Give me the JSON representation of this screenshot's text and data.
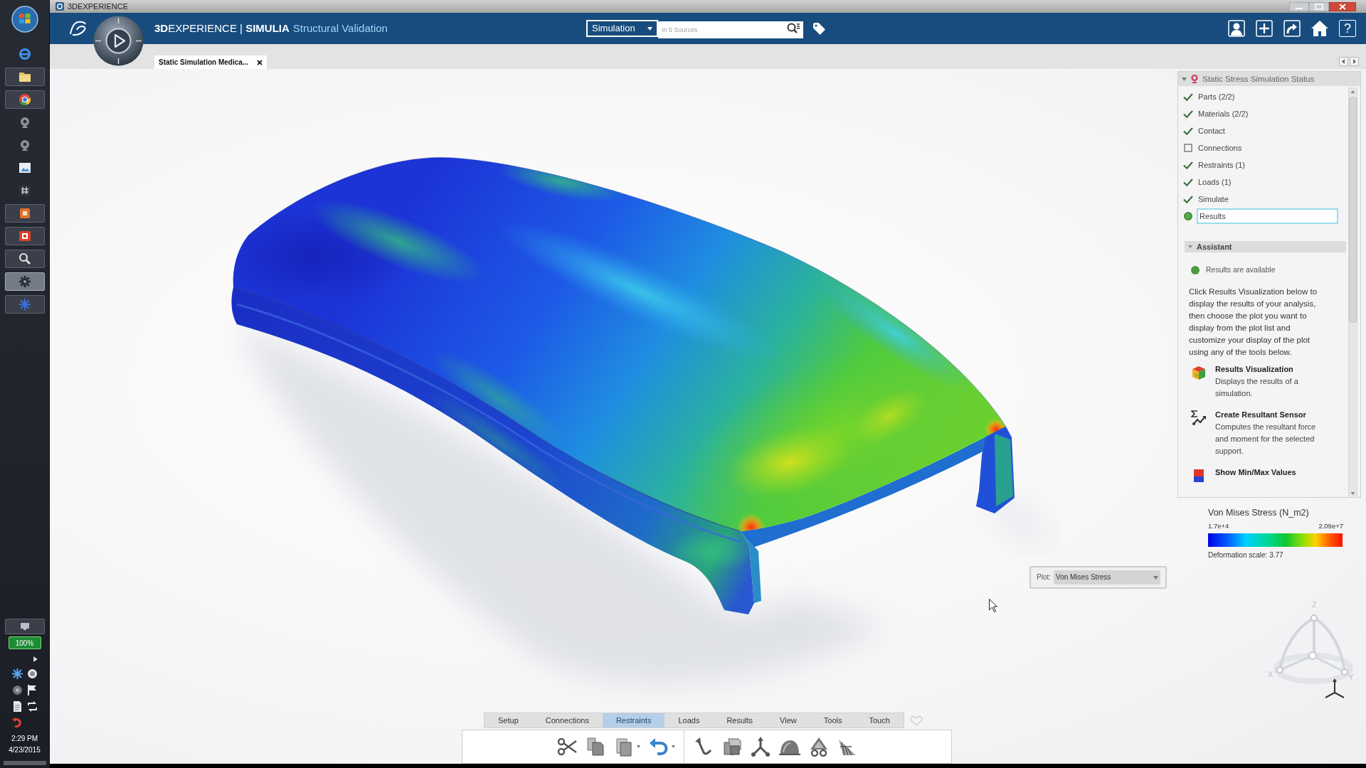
{
  "window": {
    "title": "3DEXPERIENCE"
  },
  "taskbar": {
    "apps": [
      {
        "running": false,
        "selected": false
      },
      {
        "running": true,
        "selected": false
      },
      {
        "running": true,
        "selected": false
      },
      {
        "running": false,
        "selected": false
      },
      {
        "running": false,
        "selected": false
      },
      {
        "running": false,
        "selected": false
      },
      {
        "running": false,
        "selected": false
      },
      {
        "running": true,
        "selected": false
      },
      {
        "running": true,
        "selected": false
      },
      {
        "running": true,
        "selected": false
      },
      {
        "running": true,
        "selected": true
      },
      {
        "running": true,
        "selected": false
      }
    ],
    "battery": "100%",
    "time": "2:29 PM",
    "date": "4/23/2015"
  },
  "top_bar": {
    "brand": "**3D**EXPERIENCE | **SIMULIA**",
    "app": "Structural Validation",
    "search": {
      "scope": "Simulation",
      "placeholder": "In 5 Sources"
    },
    "help": "?"
  },
  "tabs": [
    {
      "label": "Static Simulation Medica...",
      "selected": true
    }
  ],
  "status_panel": {
    "title": "Static Stress Simulation Status",
    "expanded": true,
    "steps": [
      {
        "label": "Parts (2/2)",
        "checked": true,
        "current": false,
        "selected": false
      },
      {
        "label": "Materials (2/2)",
        "checked": true,
        "current": false,
        "selected": false
      },
      {
        "label": "Contact",
        "checked": true,
        "current": false,
        "selected": false
      },
      {
        "label": "Connections",
        "checked": false,
        "current": false,
        "selected": false
      },
      {
        "label": "Restraints (1)",
        "checked": true,
        "current": false,
        "selected": false
      },
      {
        "label": "Loads (1)",
        "checked": true,
        "current": false,
        "selected": false
      },
      {
        "label": "Simulate",
        "checked": true,
        "current": false,
        "selected": false
      },
      {
        "label": "Results",
        "checked": false,
        "current": true,
        "selected": true
      }
    ]
  },
  "assistant": {
    "title": "Assistant",
    "expanded": true,
    "status": "Results are available",
    "instructions": "Click Results Visualization below to display the results of your analysis, then choose the plot you want to display from the plot list and customize your display of the plot using any of the tools below.",
    "tools": [
      {
        "title": "Results Visualization",
        "description": "Displays the results of a simulation."
      },
      {
        "title": "Create Resultant Sensor",
        "description": "Computes the resultant force and moment for the selected support."
      },
      {
        "title": "Show Min/Max Values"
      }
    ]
  },
  "legend": {
    "title": "Von Mises Stress (N_m2)",
    "min": "1.7e+4",
    "max": "2.09e+7",
    "deformation": "Deformation scale: 3.77"
  },
  "plot": {
    "label": "Plot:",
    "value": "Von Mises Stress"
  },
  "compass": {
    "axes": [
      "Z",
      "X",
      "Y"
    ]
  },
  "action_bar": {
    "tabs": [
      {
        "label": "Setup",
        "selected": false
      },
      {
        "label": "Connections",
        "selected": false
      },
      {
        "label": "Restraints",
        "selected": true
      },
      {
        "label": "Loads",
        "selected": false
      },
      {
        "label": "Results",
        "selected": false
      },
      {
        "label": "View",
        "selected": false
      },
      {
        "label": "Tools",
        "selected": false
      },
      {
        "label": "Touch",
        "selected": false
      }
    ]
  }
}
